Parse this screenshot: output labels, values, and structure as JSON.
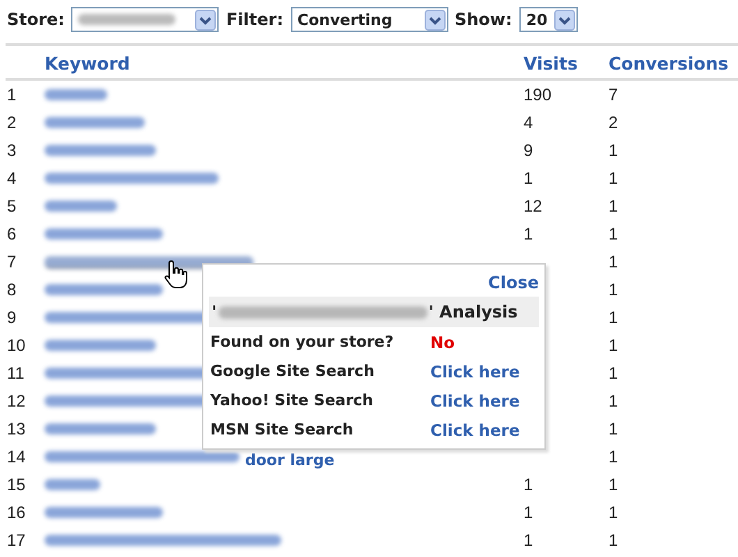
{
  "toolbar": {
    "store": {
      "label": "Store:",
      "value_blurred": true
    },
    "filter": {
      "label": "Filter:",
      "value": "Converting"
    },
    "show": {
      "label": "Show:",
      "value": "20"
    }
  },
  "table": {
    "columns": [
      "Keyword",
      "Visits",
      "Conversions"
    ],
    "rows": [
      {
        "rank": "1",
        "blurred": true,
        "visits": "190",
        "conversions": "7"
      },
      {
        "rank": "2",
        "blurred": true,
        "visits": "4",
        "conversions": "2"
      },
      {
        "rank": "3",
        "blurred": true,
        "visits": "9",
        "conversions": "1"
      },
      {
        "rank": "4",
        "blurred": true,
        "visits": "1",
        "conversions": "1"
      },
      {
        "rank": "5",
        "blurred": true,
        "visits": "12",
        "conversions": "1"
      },
      {
        "rank": "6",
        "blurred": true,
        "visits": "1",
        "conversions": "1"
      },
      {
        "rank": "7",
        "blurred": true,
        "hovered": true,
        "conversions": "1"
      },
      {
        "rank": "8",
        "blurred": true,
        "conversions": "1"
      },
      {
        "rank": "9",
        "blurred": true,
        "conversions": "1"
      },
      {
        "rank": "10",
        "blurred": true,
        "conversions": "1"
      },
      {
        "rank": "11",
        "blurred": true,
        "conversions": "1"
      },
      {
        "rank": "12",
        "blurred": true,
        "conversions": "1"
      },
      {
        "rank": "13",
        "blurred": true,
        "conversions": "1"
      },
      {
        "rank": "14",
        "blurred": true,
        "keyword_tail": "door large",
        "conversions": "1"
      },
      {
        "rank": "15",
        "blurred": true,
        "visits": "1",
        "conversions": "1"
      },
      {
        "rank": "16",
        "blurred": true,
        "visits": "1",
        "conversions": "1"
      },
      {
        "rank": "17",
        "blurred": true,
        "visits": "1",
        "conversions": "1"
      }
    ]
  },
  "popup": {
    "close": "Close",
    "title_prefix": "'",
    "title_suffix": "' Analysis",
    "rows": [
      {
        "label": "Found on your store?",
        "value": "No",
        "kind": "status"
      },
      {
        "label": "Google Site Search",
        "value": "Click here",
        "kind": "link"
      },
      {
        "label": "Yahoo! Site Search",
        "value": "Click here",
        "kind": "link"
      },
      {
        "label": "MSN Site Search",
        "value": "Click here",
        "kind": "link"
      }
    ]
  }
}
